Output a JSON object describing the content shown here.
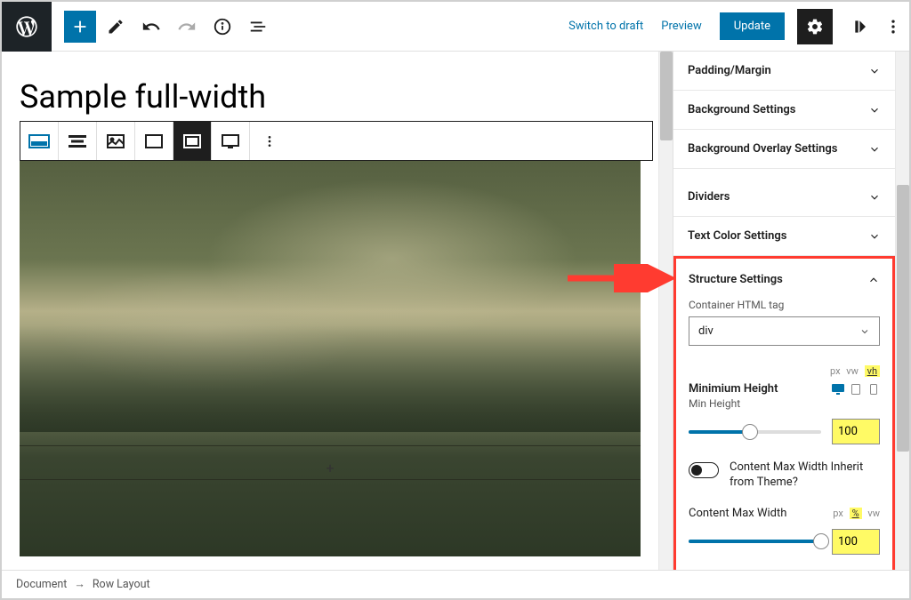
{
  "header": {
    "switch_draft": "Switch to draft",
    "preview": "Preview",
    "update": "Update"
  },
  "page": {
    "title": "Sample full-width"
  },
  "sidebar": {
    "panels": {
      "padding": "Padding/Margin",
      "background": "Background Settings",
      "overlay": "Background Overlay Settings",
      "dividers": "Dividers",
      "text_color": "Text Color Settings",
      "structure": "Structure Settings"
    },
    "structure": {
      "container_label": "Container HTML tag",
      "container_value": "div",
      "units_height": {
        "px": "px",
        "vw": "vw",
        "vh": "vh"
      },
      "min_height_label": "Minimium Height",
      "min_height_sub": "Min Height",
      "min_height_value": "100",
      "toggle_label": "Content Max Width Inherit from Theme?",
      "max_width_label": "Content Max Width",
      "units_width": {
        "px": "px",
        "pct": "%",
        "vw": "vw"
      },
      "max_width_value": "100"
    }
  },
  "breadcrumb": {
    "doc": "Document",
    "item": "Row Layout"
  }
}
